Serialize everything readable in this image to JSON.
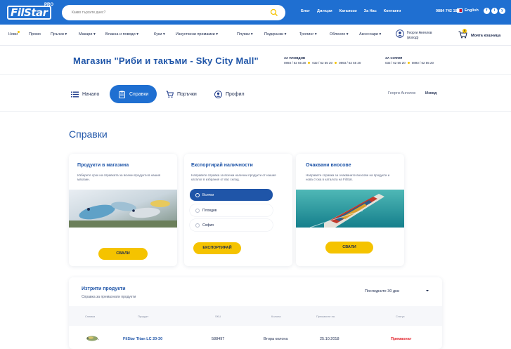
{
  "brand": {
    "logo_text": "FilStar",
    "logo_sup": "PRO"
  },
  "search": {
    "placeholder": "Какво търсите днес?"
  },
  "top_links": [
    "Блог",
    "Дилъри",
    "Каталози",
    "За Нас",
    "Контакти"
  ],
  "phone": "0884 742 185",
  "language": "English",
  "social": [
    "f",
    "i",
    "y"
  ],
  "categories": [
    "Нови",
    "Промо",
    "Пръчки",
    "Макари",
    "Влакна и поводи",
    "Куки",
    "Изкуствени примамки",
    "Плувки",
    "Подкранки",
    "Тролинг",
    "Облекло",
    "Аксесоари"
  ],
  "user": {
    "name": "Георги Ангелов",
    "sub": "(изход)"
  },
  "cart": {
    "label": "Моята кошница",
    "count": "0"
  },
  "store": {
    "title": "Магазин \"Риби и такъми - Sky City Mall\"",
    "plovdiv": {
      "label": "ЗА ПЛОВДИВ",
      "phones": [
        "0893 / 62 55 20",
        "032 / 62 55 20",
        "0893 / 62 55 20"
      ]
    },
    "sofia": {
      "label": "ЗА СОФИЯ",
      "phones": [
        "032 / 62 55 20",
        "0893 / 62 55 20"
      ]
    }
  },
  "account_tabs": [
    "Начало",
    "Справки",
    "Поръчки",
    "Профил"
  ],
  "account": {
    "name": "Георги Ангелов",
    "logout": "Изход"
  },
  "page_title": "Справки",
  "cards": {
    "in_store": {
      "title": "Продукти в магазина",
      "desc": "Изберете срок на справката за всички продукти в нашия магазин.",
      "button": "СВАЛИ"
    },
    "export": {
      "title": "Експортирай наличности",
      "desc": "Направете справка за всички налични продукти от нашия каталог в избрания от вас склад.",
      "options": [
        "Всички",
        "Пловдив",
        "София"
      ],
      "selected": "Всички",
      "button": "ЕКСПОРТИРАЙ"
    },
    "incoming": {
      "title": "Очаквани вносове",
      "desc": "Направете справка за очакваните вносове на продукти и нова стока в каталога на FilStar.",
      "button": "СВАЛИ"
    }
  },
  "deleted": {
    "title": "Изтрити продукти",
    "subtitle": "Справка за премахнати продукти",
    "period": "Последните 30 дни",
    "columns": [
      "Снимка",
      "Продукт",
      "SKU",
      "Колона",
      "Премахнат на",
      "Статус"
    ],
    "rows": [
      {
        "product": "FilStar Titan LC 20-30",
        "sku": "588497",
        "column": "Втора колона",
        "date": "25.10.2018",
        "status": "Премахнат"
      }
    ]
  },
  "colors": {
    "primary": "#1f6fd1",
    "accent": "#f5c300",
    "title": "#1f55a8",
    "status_removed": "#e2212a"
  }
}
